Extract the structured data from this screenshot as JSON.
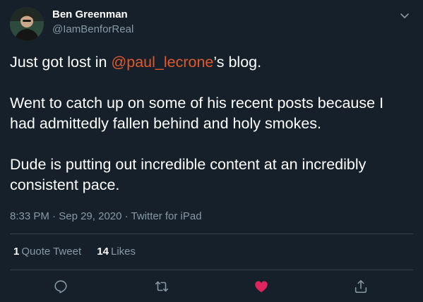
{
  "author": {
    "display_name": "Ben Greenman",
    "handle": "@IamBenforReal"
  },
  "tweet": {
    "line1_before": "Just got lost in ",
    "mention": "@paul_lecrone",
    "line1_after": "’s blog.",
    "paragraph2": "Went to catch up on some of his recent posts because I had admittedly fallen behind and holy smokes.",
    "paragraph3": "Dude is putting out incredible content at an incredibly consistent pace."
  },
  "meta": {
    "time": "8:33 PM",
    "separator": " · ",
    "date": "Sep 29, 2020",
    "source": "Twitter for iPad"
  },
  "stats": {
    "quote_count": "1",
    "quote_label": "Quote Tweet",
    "like_count": "14",
    "like_label": "Likes"
  },
  "colors": {
    "background": "#15202b",
    "mention": "#e0592a",
    "muted": "#8899a6",
    "like_active": "#e0245e"
  },
  "icons": {
    "menu": "chevron-down-icon",
    "reply": "reply-icon",
    "retweet": "retweet-icon",
    "like": "heart-icon",
    "share": "share-icon"
  }
}
